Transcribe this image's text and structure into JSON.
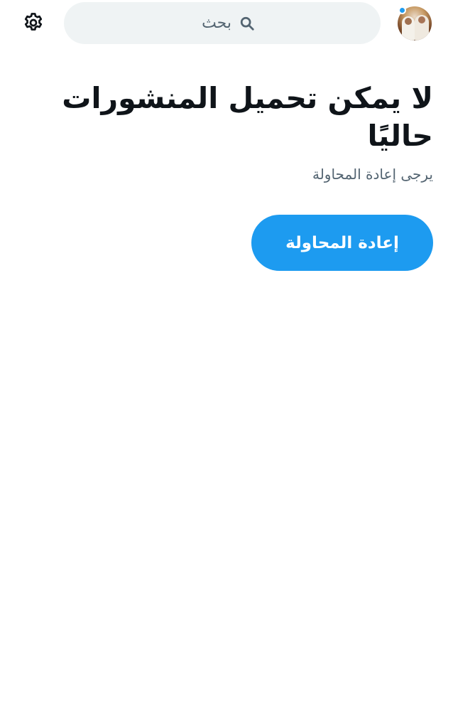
{
  "header": {
    "settings_icon": "gear-icon",
    "search": {
      "placeholder": "بحث",
      "icon": "search-icon"
    },
    "avatar": {
      "has_notification": true
    }
  },
  "main": {
    "title": "لا يمكن تحميل المنشورات حاليًا",
    "subtitle": "يرجى إعادة المحاولة",
    "retry_label": "إعادة المحاولة"
  },
  "colors": {
    "accent": "#1d9bf0",
    "text": "#0f1419",
    "secondary_text": "#536471",
    "search_bg": "#eff3f4"
  }
}
